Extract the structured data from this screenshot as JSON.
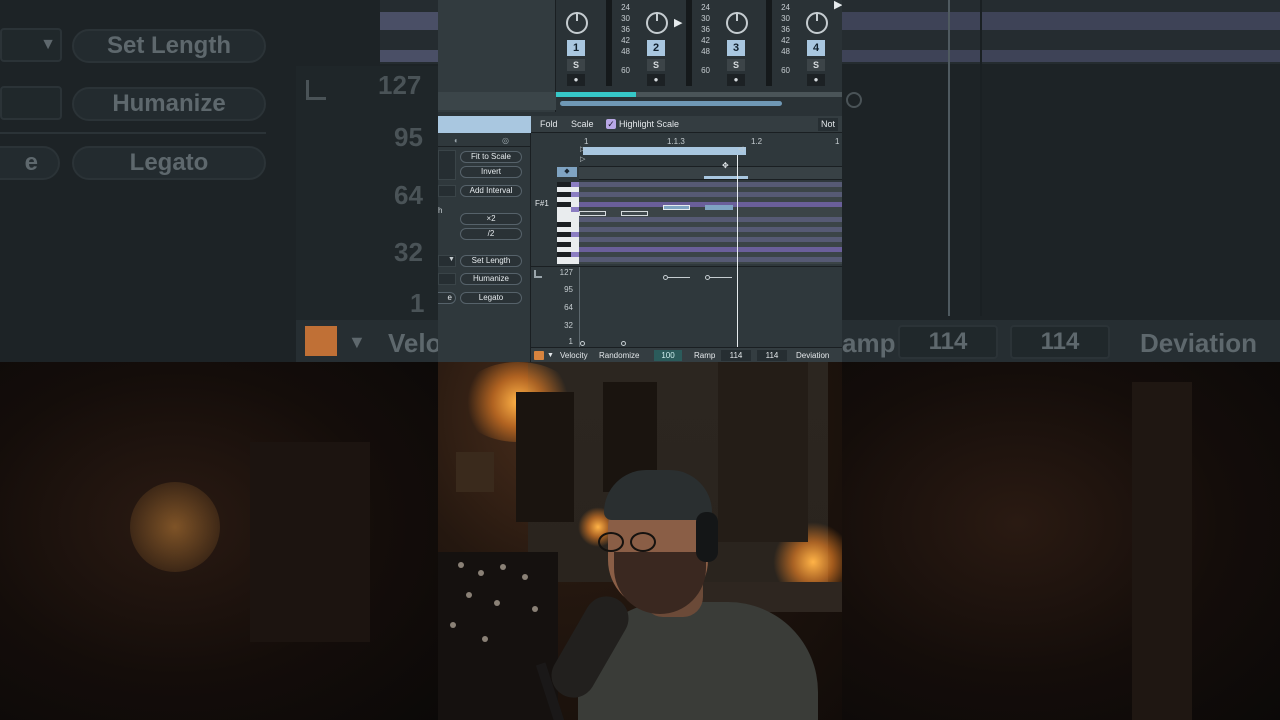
{
  "side_left": {
    "pills": [
      "Set Length",
      "Humanize",
      "Legato"
    ],
    "numbers": [
      "127",
      "95",
      "64",
      "32",
      "1"
    ],
    "partial_e": "e",
    "velo_text": "Velo"
  },
  "side_right": {
    "ramp_text": "amp",
    "val1": "114",
    "val2": "114",
    "deviation": "Deviation"
  },
  "mixer": {
    "tracks": [
      {
        "number": "1",
        "solo": "S",
        "rec": "●"
      },
      {
        "number": "2",
        "solo": "S",
        "rec": "●"
      },
      {
        "number": "3",
        "solo": "S",
        "rec": "●"
      },
      {
        "number": "4",
        "solo": "S",
        "rec": "●"
      }
    ],
    "meter_scale": [
      "24",
      "30",
      "36",
      "42",
      "48",
      "60"
    ]
  },
  "toolbar": {
    "fold": "Fold",
    "scale": "Scale",
    "highlight_scale": "Highlight Scale",
    "highlight_checked": true,
    "not_label": "Not"
  },
  "tools": {
    "fit_to_scale": "Fit to Scale",
    "invert": "Invert",
    "add_interval": "Add Interval",
    "h_label": "h",
    "times2": "×2",
    "div2": "/2",
    "set_length": "Set Length",
    "humanize": "Humanize",
    "e_label": "e",
    "legato": "Legato"
  },
  "roll": {
    "ruler": [
      "1",
      "1.1.3",
      "1.2",
      "1"
    ],
    "key_label": "F#1",
    "velocity_scale": [
      "127",
      "95",
      "64",
      "32",
      "1"
    ]
  },
  "bottombar": {
    "velocity": "Velocity",
    "randomize": "Randomize",
    "randomize_value": "100",
    "ramp": "Ramp",
    "ramp_start": "114",
    "ramp_end": "114",
    "deviation": "Deviation"
  },
  "colors": {
    "accent_blue": "#a9c7e0",
    "accent_teal": "#36c8c8",
    "scale_purple": "#8b7dc2",
    "panel": "#2f383c"
  }
}
